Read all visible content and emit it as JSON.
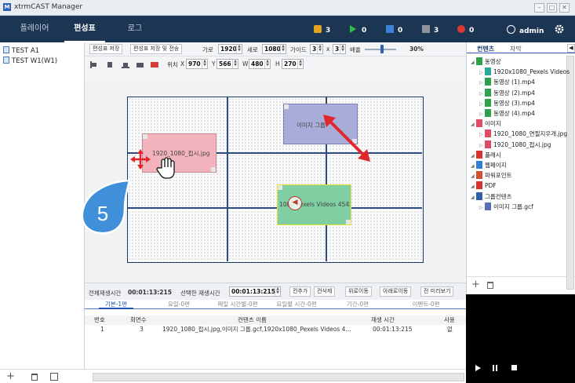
{
  "window": {
    "title": "xtrmCAST Manager",
    "logo_letter": "M",
    "buttons": [
      "–",
      "□",
      "✕"
    ]
  },
  "nav": {
    "tabs": [
      {
        "label": "플레이어"
      },
      {
        "label": "편성표"
      },
      {
        "label": "로그"
      }
    ],
    "active_tab": "편성표",
    "stats": [
      {
        "icon": "warning-square-icon",
        "value": "3",
        "color": "#e5a323"
      },
      {
        "icon": "play-icon",
        "value": "0",
        "color": "#2fbf45"
      },
      {
        "icon": "square-blue-icon",
        "value": "0",
        "color": "#3d80d6"
      },
      {
        "icon": "square-gray-icon",
        "value": "3",
        "color": "#8e949b"
      },
      {
        "icon": "error-circle-icon",
        "value": "0",
        "color": "#d93a2f"
      }
    ],
    "user": "admin"
  },
  "schedules": [
    {
      "label": "TEST A1"
    },
    {
      "label": "TEST W1(W1)"
    }
  ],
  "toolbar": {
    "save": "편성표 저장",
    "save_send": "편성표 저장 및 전송",
    "width_label": "가로",
    "width_value": "1920",
    "height_label": "세로",
    "height_value": "1080",
    "guide_label": "가이드",
    "guide_x": "3",
    "guide_sep": "x",
    "guide_y": "3",
    "zoom_label": "배율",
    "zoom_value": "30%",
    "position_label": "위치",
    "x_label": "X",
    "x_value": "970",
    "y_label": "Y",
    "y_value": "566",
    "w_label": "W",
    "w_value": "480",
    "h_label": "H",
    "h_value": "270"
  },
  "canvas": {
    "clips": [
      {
        "label": "1920_1080_접시.jpg",
        "color": "#f3b3bd"
      },
      {
        "label": "이미지 그룹",
        "color": "#a9acd8"
      },
      {
        "label": "1080 Pexels Videos 4545",
        "color": "#7fcfa3"
      }
    ],
    "callout_number": "5",
    "accent": "#e0262b"
  },
  "bottom": {
    "total_label": "전체재생시간",
    "total_value": "00:01:13:215",
    "selected_label": "선택한 재생시간",
    "selected_value": "00:01:13:215",
    "buttons": [
      "컨추가",
      "컨삭제",
      "위로이동",
      "아래로이동",
      "전 미리보기"
    ]
  },
  "subtabs": [
    {
      "label": "기본-1편"
    },
    {
      "label": "요일-0편"
    },
    {
      "label": "페일 시간별-0편"
    },
    {
      "label": "요일별 시간-0편"
    },
    {
      "label": "기간-0편"
    },
    {
      "label": "이벤트-0편"
    }
  ],
  "table": {
    "headers": [
      "번호",
      "회면수",
      "컨텐츠 이름",
      "재생 시간",
      "사용"
    ],
    "rows": [
      [
        "1",
        "3",
        "1920_1080_접시.jpg,이미지 그룹.gcf,1920x1080_Pexels Videos 4...",
        "00:01:13:215",
        "없"
      ]
    ]
  },
  "right": {
    "tabs": [
      "컨텐츠",
      "자막"
    ],
    "tree": [
      {
        "label": "동영상",
        "level": 0,
        "icon": "video-folder-icon",
        "color": "#2fa24a"
      },
      {
        "label": "1920x1080_Pexels Videos",
        "level": 1,
        "icon": "video-file-icon",
        "color": "#2bab95"
      },
      {
        "label": "동영상 (1).mp4",
        "level": 1,
        "icon": "video-file-icon",
        "color": "#2fa24a"
      },
      {
        "label": "동영상 (2).mp4",
        "level": 1,
        "icon": "video-file-icon",
        "color": "#2fa24a"
      },
      {
        "label": "동영상 (3).mp4",
        "level": 1,
        "icon": "video-file-icon",
        "color": "#2fa24a"
      },
      {
        "label": "동영상 (4).mp4",
        "level": 1,
        "icon": "video-file-icon",
        "color": "#2fa24a"
      },
      {
        "label": "이미지",
        "level": 0,
        "icon": "image-folder-icon",
        "color": "#e24b64"
      },
      {
        "label": "1920_1080_연필지우개.jpg",
        "level": 1,
        "icon": "image-file-icon",
        "color": "#e24b64"
      },
      {
        "label": "1920_1080_접시.jpg",
        "level": 1,
        "icon": "image-file-icon",
        "color": "#e24b64"
      },
      {
        "label": "플래시",
        "level": 0,
        "icon": "flash-icon",
        "color": "#d8332d"
      },
      {
        "label": "웹페이지",
        "level": 0,
        "icon": "web-icon",
        "color": "#2f7fd6"
      },
      {
        "label": "파워포인트",
        "level": 0,
        "icon": "ppt-icon",
        "color": "#d2512b"
      },
      {
        "label": "PDF",
        "level": 0,
        "icon": "pdf-icon",
        "color": "#d8332d"
      },
      {
        "label": "그룹컨텐츠",
        "level": 0,
        "icon": "group-folder-icon",
        "color": "#2f5fa8"
      },
      {
        "label": "이미지 그룹.gcf",
        "level": 1,
        "icon": "group-file-icon",
        "color": "#5a6fb5"
      }
    ],
    "player_controls": [
      "play-icon",
      "pause-icon",
      "stop-icon"
    ]
  }
}
